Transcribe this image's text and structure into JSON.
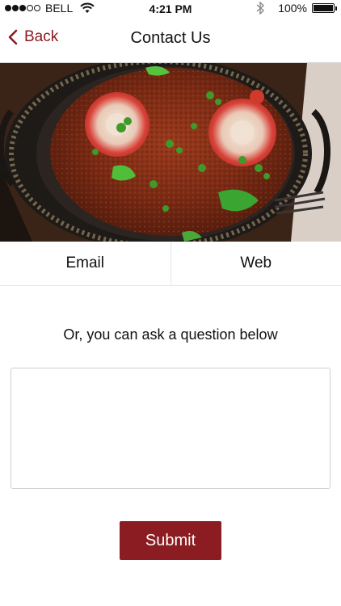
{
  "status_bar": {
    "carrier": "BELL",
    "time": "4:21 PM",
    "battery": "100%",
    "battery_level": 1.0,
    "signal_bars": 3,
    "signal_total": 5
  },
  "nav": {
    "back_label": "Back",
    "title": "Contact Us"
  },
  "hero": {
    "alt": "Bowl of curry with tomato slices, green peppers and cilantro"
  },
  "contact_options": {
    "email_label": "Email",
    "web_label": "Web"
  },
  "question": {
    "prompt": "Or, you can ask a question below",
    "value": "",
    "placeholder": ""
  },
  "submit_label": "Submit",
  "colors": {
    "accent": "#8b1c21"
  }
}
